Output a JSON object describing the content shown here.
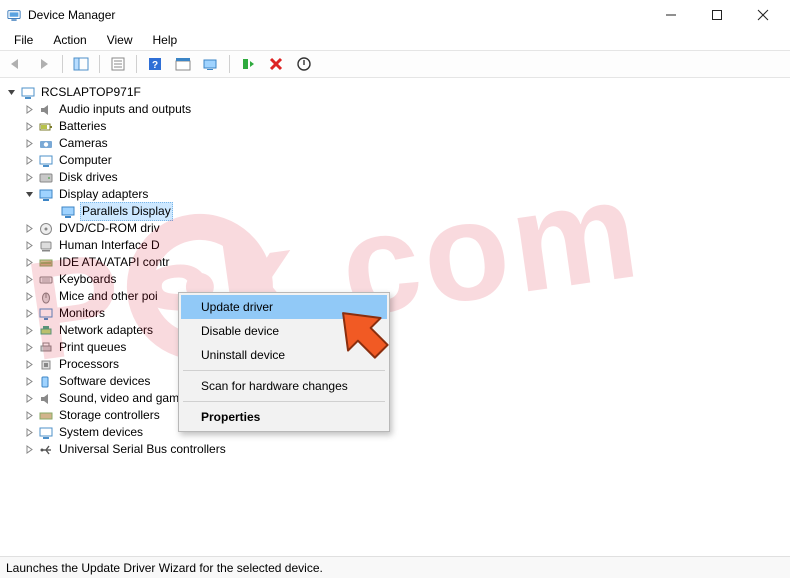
{
  "window": {
    "title": "Device Manager"
  },
  "menu": [
    "File",
    "Action",
    "View",
    "Help"
  ],
  "tree": {
    "root": {
      "label": "RCSLAPTOP971F",
      "expanded": true
    },
    "categories": [
      {
        "label": "Audio inputs and outputs",
        "expanded": false
      },
      {
        "label": "Batteries",
        "expanded": false
      },
      {
        "label": "Cameras",
        "expanded": false
      },
      {
        "label": "Computer",
        "expanded": false
      },
      {
        "label": "Disk drives",
        "expanded": false
      },
      {
        "label": "Display adapters",
        "expanded": true
      },
      {
        "label": "DVD/CD-ROM driv",
        "expanded": false
      },
      {
        "label": "Human Interface D",
        "expanded": false
      },
      {
        "label": "IDE ATA/ATAPI contr",
        "expanded": false
      },
      {
        "label": "Keyboards",
        "expanded": false
      },
      {
        "label": "Mice and other poi",
        "expanded": false
      },
      {
        "label": "Monitors",
        "expanded": false
      },
      {
        "label": "Network adapters",
        "expanded": false
      },
      {
        "label": "Print queues",
        "expanded": false
      },
      {
        "label": "Processors",
        "expanded": false
      },
      {
        "label": "Software devices",
        "expanded": false
      },
      {
        "label": "Sound, video and game controllers",
        "expanded": false
      },
      {
        "label": "Storage controllers",
        "expanded": false
      },
      {
        "label": "System devices",
        "expanded": false
      },
      {
        "label": "Universal Serial Bus controllers",
        "expanded": false
      }
    ],
    "selected_child": {
      "label": "Parallels Display"
    }
  },
  "context_menu": {
    "items": [
      {
        "label": "Update driver",
        "highlight": true
      },
      {
        "label": "Disable device"
      },
      {
        "label": "Uninstall device"
      }
    ],
    "scan_label": "Scan for hardware changes",
    "properties_label": "Properties"
  },
  "statusbar": {
    "text": "Launches the Update Driver Wizard for the selected device."
  }
}
